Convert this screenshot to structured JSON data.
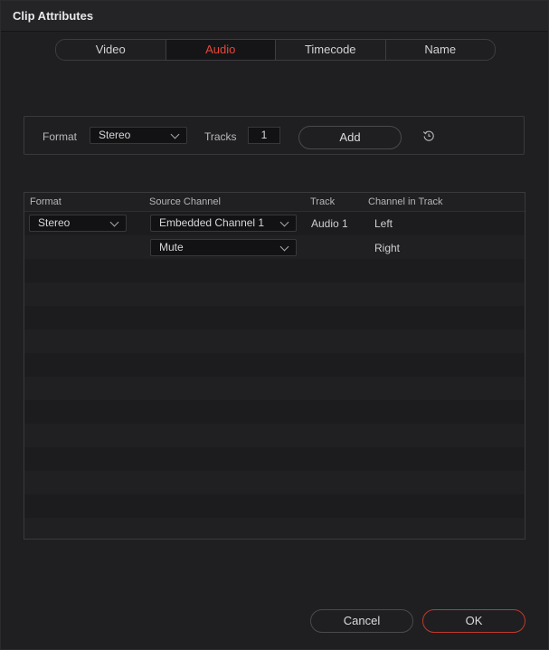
{
  "window": {
    "title": "Clip Attributes"
  },
  "tabs": [
    {
      "label": "Video",
      "active": false
    },
    {
      "label": "Audio",
      "active": true
    },
    {
      "label": "Timecode",
      "active": false
    },
    {
      "label": "Name",
      "active": false
    }
  ],
  "format_bar": {
    "format_label": "Format",
    "format_value": "Stereo",
    "tracks_label": "Tracks",
    "tracks_value": "1",
    "add_label": "Add"
  },
  "table": {
    "headers": [
      "Format",
      "Source Channel",
      "Track",
      "Channel in Track"
    ],
    "rows": [
      {
        "format": "Stereo",
        "source": "Embedded Channel 1",
        "track": "Audio 1",
        "channel": "Left"
      },
      {
        "format": "",
        "source": "Mute",
        "track": "",
        "channel": "Right"
      }
    ]
  },
  "footer": {
    "cancel_label": "Cancel",
    "ok_label": "OK"
  },
  "colors": {
    "accent": "#e5463a",
    "background": "#1f1f21"
  }
}
